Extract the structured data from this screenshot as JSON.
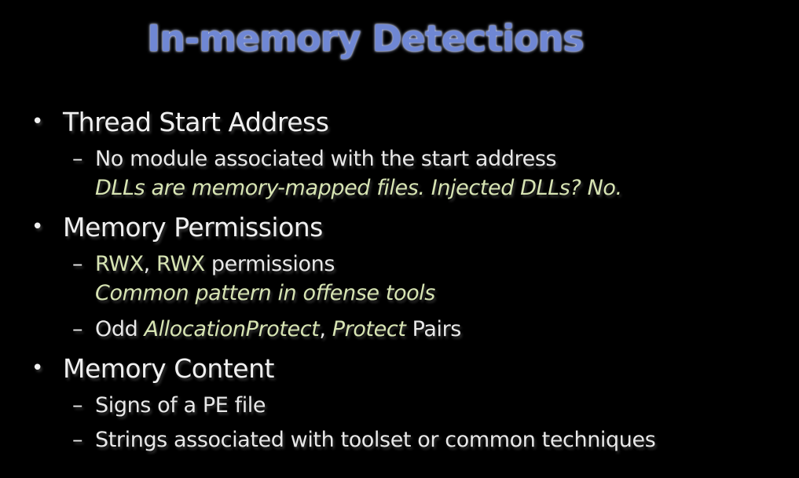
{
  "slide": {
    "title": "In-memory Detections",
    "bullet_glyph": "•",
    "dash_glyph": "–",
    "sections": [
      {
        "heading": "Thread Start Address",
        "items": [
          {
            "text": "No module associated with the start address",
            "note": "DLLs are memory-mapped files. Injected DLLs? No."
          }
        ]
      },
      {
        "heading": "Memory Permissions",
        "items": [
          {
            "part1": "RWX",
            "sep1": ", ",
            "part2": "RWX",
            "part3": " permissions",
            "note": "Common pattern in offense tools"
          },
          {
            "part1": "Odd ",
            "part2": "AllocationProtect",
            "sep": ", ",
            "part3": "Protect",
            "part4": " Pairs"
          }
        ]
      },
      {
        "heading": "Memory Content",
        "items": [
          {
            "text": "Signs of a PE file"
          },
          {
            "text": "Strings associated with toolset or common techniques"
          }
        ]
      }
    ]
  },
  "colors": {
    "background": "#000000",
    "title": "#6f87d4",
    "body_text": "#ececec",
    "highlight": "#d7e4b3"
  }
}
